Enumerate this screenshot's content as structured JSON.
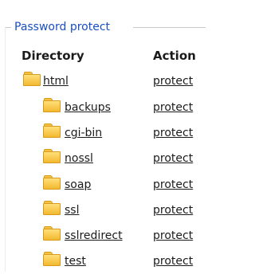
{
  "panel": {
    "legend": "Password protect",
    "headers": {
      "directory": "Directory",
      "action": "Action"
    },
    "rows": [
      {
        "name": "html",
        "action": "protect"
      },
      {
        "name": "backups",
        "action": "protect"
      },
      {
        "name": "cgi-bin",
        "action": "protect"
      },
      {
        "name": "nossl",
        "action": "protect"
      },
      {
        "name": "soap",
        "action": "protect"
      },
      {
        "name": "ssl",
        "action": "protect"
      },
      {
        "name": "sslredirect",
        "action": "protect"
      },
      {
        "name": "test",
        "action": "protect"
      }
    ]
  },
  "colors": {
    "legend": "#1a4fc0",
    "folder": "#f3b830",
    "text": "#1b1b1b"
  },
  "icons": {
    "folder": "folder-icon"
  }
}
